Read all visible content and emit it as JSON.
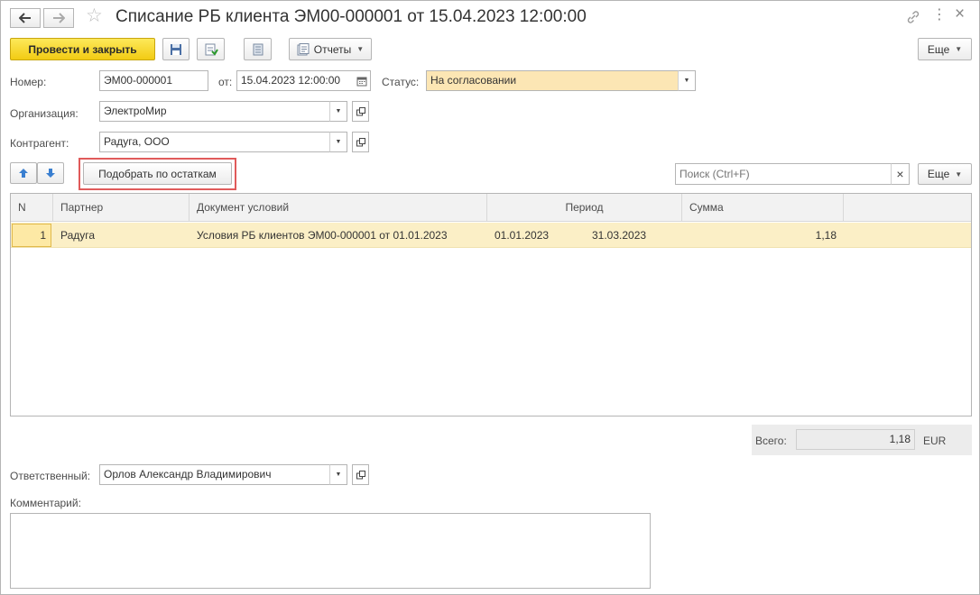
{
  "window": {
    "title": "Списание РБ клиента ЭМ00-000001 от 15.04.2023 12:00:00"
  },
  "toolbar": {
    "post_close_label": "Провести и закрыть",
    "reports_label": "Отчеты",
    "more_label": "Еще"
  },
  "form": {
    "number_label": "Номер:",
    "number_value": "ЭМ00-000001",
    "date_label": "от:",
    "date_value": "15.04.2023 12:00:00",
    "status_label": "Статус:",
    "status_value": "На согласовании",
    "organization_label": "Организация:",
    "organization_value": "ЭлектроМир",
    "counterparty_label": "Контрагент:",
    "counterparty_value": "Радуга, ООО"
  },
  "table_toolbar": {
    "pick_label": "Подобрать по остаткам",
    "search_placeholder": "Поиск (Ctrl+F)",
    "more_label": "Еще"
  },
  "table": {
    "headers": {
      "n": "N",
      "partner": "Партнер",
      "doc": "Документ условий",
      "period": "Период",
      "sum": "Сумма"
    },
    "rows": [
      {
        "n": "1",
        "partner": "Радуга",
        "doc": "Условия РБ клиентов ЭМ00-000001 от 01.01.2023",
        "period_start": "01.01.2023",
        "period_end": "31.03.2023",
        "sum": "1,18"
      }
    ]
  },
  "totals": {
    "label": "Всего:",
    "value": "1,18",
    "currency": "EUR"
  },
  "footer": {
    "responsible_label": "Ответственный:",
    "responsible_value": "Орлов Александр Владимирович",
    "comment_label": "Комментарий:"
  },
  "colors": {
    "primary_button": "#f2cb13",
    "status_field": "#fce6b4",
    "selected_row": "#fbefc6",
    "highlight_frame": "#e05a5a"
  }
}
